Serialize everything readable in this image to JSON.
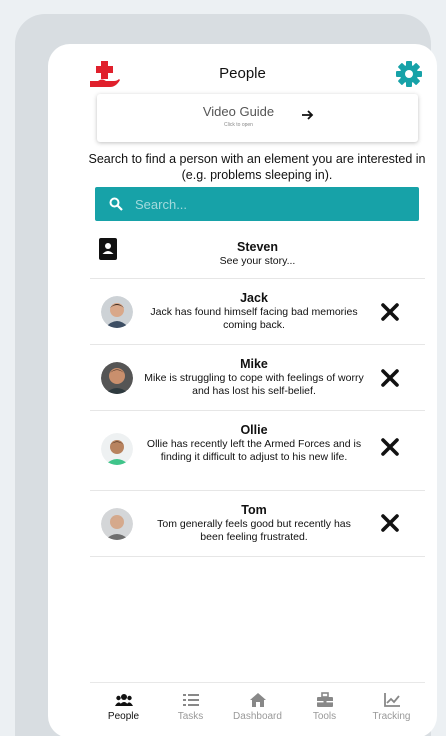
{
  "header": {
    "title": "People"
  },
  "video_guide": {
    "title": "Video Guide",
    "subtitle": "Click to open"
  },
  "search": {
    "hint": "Search to find a person with an element you are interested in (e.g. problems sleeping in).",
    "placeholder": "Search..."
  },
  "self": {
    "name": "Steven",
    "description": "See your story..."
  },
  "people": [
    {
      "name": "Jack",
      "description": "Jack has found himself facing bad memories coming back."
    },
    {
      "name": "Mike",
      "description": "Mike is struggling to cope with feelings of worry and has lost his self-belief."
    },
    {
      "name": "Ollie",
      "description": "Ollie has recently left the Armed Forces and is finding it difficult to adjust to his new life."
    },
    {
      "name": "Tom",
      "description": "Tom generally feels good but recently has been feeling frustrated."
    }
  ],
  "nav": {
    "items": [
      {
        "label": "People",
        "icon": "users-icon",
        "active": true
      },
      {
        "label": "Tasks",
        "icon": "list-icon",
        "active": false
      },
      {
        "label": "Dashboard",
        "icon": "home-icon",
        "active": false
      },
      {
        "label": "Tools",
        "icon": "toolbox-icon",
        "active": false
      },
      {
        "label": "Tracking",
        "icon": "chart-line-icon",
        "active": false
      }
    ]
  },
  "colors": {
    "accent": "#17a2a8",
    "logo": "#e0202c",
    "background": "#ecf0f3",
    "device": "#d8dde1"
  }
}
